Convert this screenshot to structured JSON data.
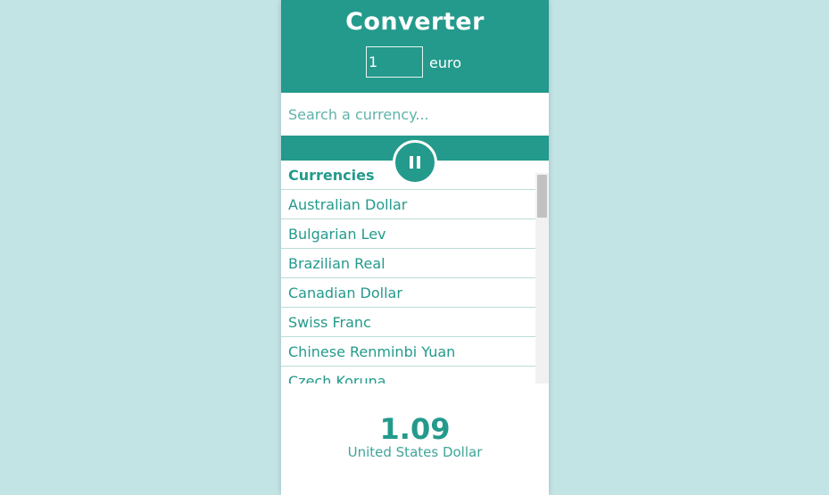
{
  "header": {
    "title": "Converter",
    "amount_value": "1",
    "amount_unit": "euro"
  },
  "search": {
    "placeholder": "Search a currency..."
  },
  "currency_list": {
    "heading": "Currencies",
    "items": [
      "Australian Dollar",
      "Bulgarian Lev",
      "Brazilian Real",
      "Canadian Dollar",
      "Swiss Franc",
      "Chinese Renminbi Yuan",
      "Czech Koruna"
    ]
  },
  "result": {
    "value": "1.09",
    "currency": "United States Dollar"
  },
  "icons": {
    "toggle": "pause-icon"
  },
  "colors": {
    "accent": "#239a8c",
    "background": "#c3e4e5",
    "panel": "#ffffff"
  }
}
